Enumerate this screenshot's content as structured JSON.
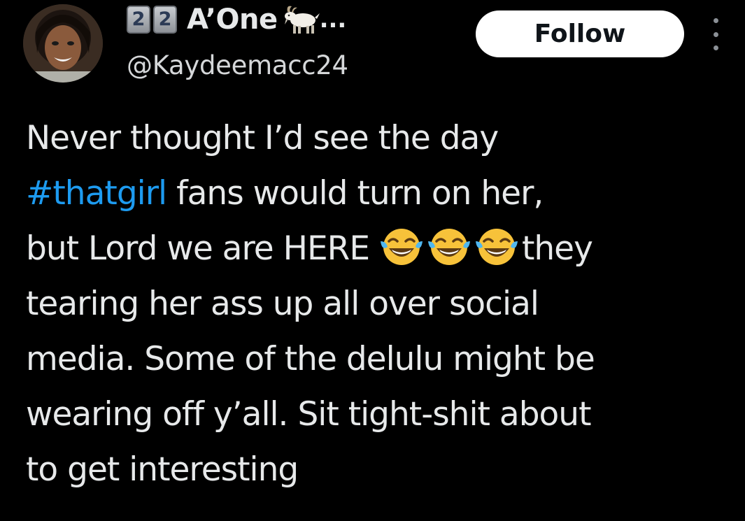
{
  "author": {
    "name_prefix_digits": [
      "2",
      "2"
    ],
    "display_name": "A’One",
    "name_suffix_icon": "goat-icon",
    "name_ellipsis": "...",
    "handle": "@Kaydeemacc24"
  },
  "actions": {
    "follow_label": "Follow",
    "more_icon": "more-vertical-icon"
  },
  "tweet": {
    "lines": [
      "Never thought I’d see the day",
      "fans would turn on her,",
      "but Lord we are HERE",
      "they",
      "tearing her ass up all over social",
      "media. Some of the delulu might be",
      "wearing off y’all. Sit tight-shit about",
      "to get interesting"
    ],
    "hashtag": "#thatgirl",
    "emoji_name": "face-with-tears-of-joy-icon",
    "emoji_count": 3
  },
  "colors": {
    "background": "#000000",
    "text": "#e7e9ea",
    "handle": "#d5d7d9",
    "link": "#1d9bf0",
    "follow_bg": "#ffffff",
    "follow_text": "#0f1419"
  }
}
